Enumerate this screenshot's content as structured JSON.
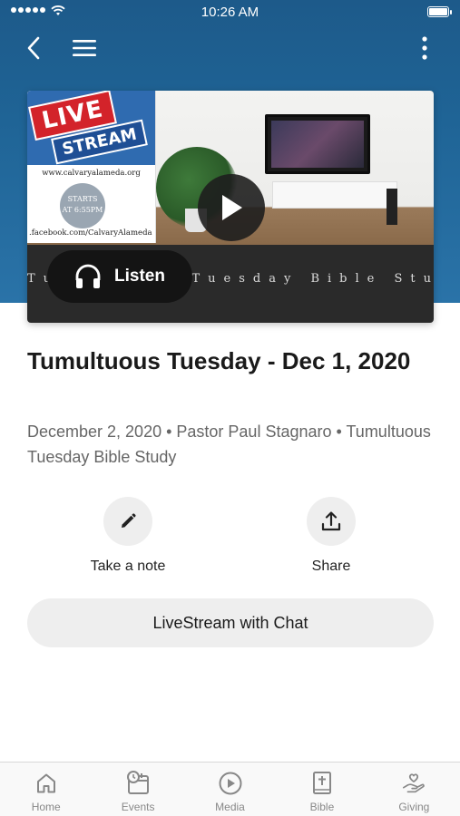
{
  "status_bar": {
    "time": "10:26 AM"
  },
  "media": {
    "badge": {
      "live": "LIVE",
      "stream": "STREAM",
      "url": "www.calvaryalameda.org",
      "starts_line1": "STARTS",
      "starts_line2": "AT 6:55PM",
      "facebook": ".facebook.com/CalvaryAlameda"
    },
    "subtitle_strip": "Tumultuous Tuesday Bible Study",
    "listen_label": "Listen"
  },
  "title": "Tumultuous Tuesday - Dec 1, 2020",
  "meta": "December 2, 2020 • Pastor Paul Stagnaro • Tumultuous Tuesday Bible Study",
  "actions": {
    "take_note": "Take a note",
    "share": "Share"
  },
  "livestream_button": "LiveStream with Chat",
  "tabs": [
    {
      "label": "Home",
      "icon": "home-icon"
    },
    {
      "label": "Events",
      "icon": "calendar-clock-icon"
    },
    {
      "label": "Media",
      "icon": "play-circle-icon"
    },
    {
      "label": "Bible",
      "icon": "bible-icon"
    },
    {
      "label": "Giving",
      "icon": "giving-hand-icon"
    }
  ]
}
